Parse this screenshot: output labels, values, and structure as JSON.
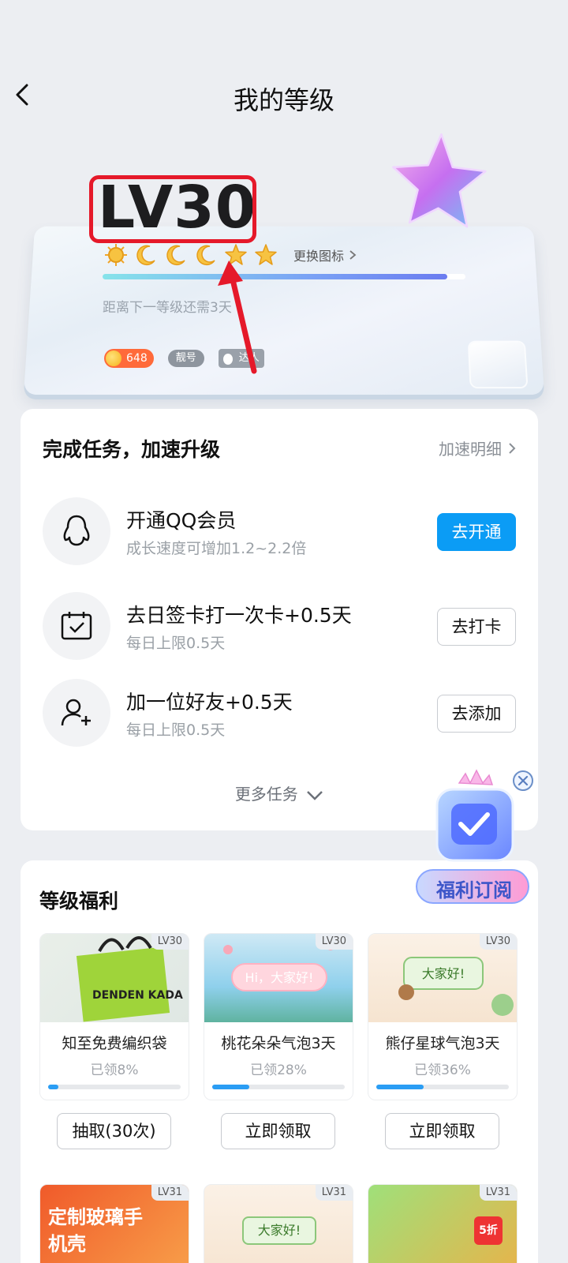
{
  "header": {
    "title": "我的等级"
  },
  "level": {
    "label": "LV30",
    "change_icon_label": "更换图标",
    "progress": 0.95,
    "next_level_text": "距离下一等级还需3天",
    "coins": "648",
    "badge_pretty": "靓号",
    "badge_expert": "达人",
    "icons": [
      "sun-icon",
      "moon-icon",
      "moon-icon",
      "moon-icon",
      "star-icon",
      "star-icon"
    ]
  },
  "tasks": {
    "title": "完成任务，加速升级",
    "detail_link": "加速明细",
    "items": [
      {
        "name": "开通QQ会员",
        "desc": "成长速度可增加1.2~2.2倍",
        "button": "去开通",
        "icon": "penguin-icon"
      },
      {
        "name": "去日签卡打一次卡+0.5天",
        "desc": "每日上限0.5天",
        "button": "去打卡",
        "icon": "calendar-check-icon"
      },
      {
        "name": "加一位好友+0.5天",
        "desc": "每日上限0.5天",
        "button": "去添加",
        "icon": "add-friend-icon"
      }
    ],
    "more": "更多任务"
  },
  "promo": {
    "label": "福利订阅"
  },
  "benefits": {
    "title": "等级福利",
    "items": [
      {
        "tag": "LV30",
        "name": "知至免费编织袋",
        "claimed": "已领8%",
        "progress": 0.08,
        "button": "抽取(30次)",
        "thumb_text": "DENDEN KADA"
      },
      {
        "tag": "LV30",
        "name": "桃花朵朵气泡3天",
        "claimed": "已领28%",
        "progress": 0.28,
        "button": "立即领取",
        "thumb_text": "Hi，大家好!"
      },
      {
        "tag": "LV30",
        "name": "熊仔星球气泡3天",
        "claimed": "已领36%",
        "progress": 0.36,
        "button": "立即领取",
        "thumb_text": "大家好!"
      }
    ],
    "row2": [
      {
        "tag": "LV31",
        "thumb_text": "定制玻璃手机壳"
      },
      {
        "tag": "LV31",
        "thumb_text": "大家好!"
      },
      {
        "tag": "LV31",
        "thumb_text": "5折"
      }
    ]
  },
  "colors": {
    "accent": "#0b9cf5",
    "highlight_red": "#e5192a",
    "progress_blue": "#2a9df4"
  }
}
